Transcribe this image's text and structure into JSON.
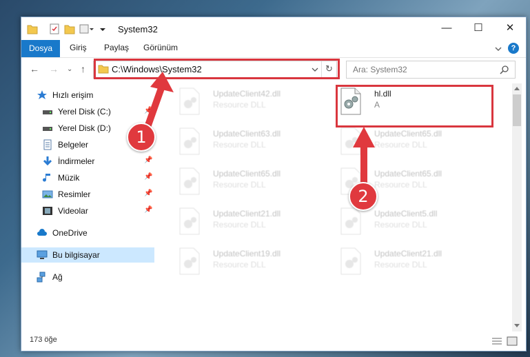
{
  "window": {
    "title": "System32",
    "controls": {
      "minimize": "—",
      "maximize": "☐",
      "close": "✕"
    }
  },
  "ribbon": {
    "tabs": [
      "Dosya",
      "Giriş",
      "Paylaş",
      "Görünüm"
    ],
    "help": "?"
  },
  "nav": {
    "address": "C:\\Windows\\System32",
    "search_placeholder": "Ara: System32"
  },
  "sidebar": {
    "items": [
      {
        "label": "Hızlı erişim",
        "icon": "star-icon"
      },
      {
        "label": "Yerel Disk (C:)",
        "icon": "drive-icon"
      },
      {
        "label": "Yerel Disk (D:)",
        "icon": "drive-icon"
      },
      {
        "label": "Belgeler",
        "icon": "documents-icon"
      },
      {
        "label": "İndirmeler",
        "icon": "download-icon"
      },
      {
        "label": "Müzik",
        "icon": "music-icon"
      },
      {
        "label": "Resimler",
        "icon": "pictures-icon"
      },
      {
        "label": "Videolar",
        "icon": "video-icon"
      },
      {
        "label": "OneDrive",
        "icon": "cloud-icon"
      },
      {
        "label": "Bu bilgisayar",
        "icon": "computer-icon"
      },
      {
        "label": "Ağ",
        "icon": "network-icon"
      }
    ]
  },
  "files": {
    "left": [
      {
        "name": "UpdateClient42.dll",
        "desc": "Resource DLL"
      },
      {
        "name": "UpdateClient63.dll",
        "desc": "Resource DLL"
      },
      {
        "name": "UpdateClient65.dll",
        "desc": "Resource DLL"
      },
      {
        "name": "UpdateClient21.dll",
        "desc": "Resource DLL"
      },
      {
        "name": "UpdateClient19.dll",
        "desc": "Resource DLL"
      }
    ],
    "right": [
      {
        "name": "hl.dll",
        "desc": "A"
      },
      {
        "name": "UpdateClient65.dll",
        "desc": "Resource DLL"
      },
      {
        "name": "UpdateClient65.dll",
        "desc": "Resource DLL"
      },
      {
        "name": "UpdateClient5.dll",
        "desc": "Resource DLL"
      },
      {
        "name": "UpdateClient21.dll",
        "desc": "Resource DLL"
      }
    ]
  },
  "status": {
    "count": "173 öğe"
  },
  "annotations": {
    "step1": "1",
    "step2": "2"
  },
  "colors": {
    "accent": "#1979ca",
    "highlight": "#d9363e",
    "selected": "#cce8ff"
  }
}
